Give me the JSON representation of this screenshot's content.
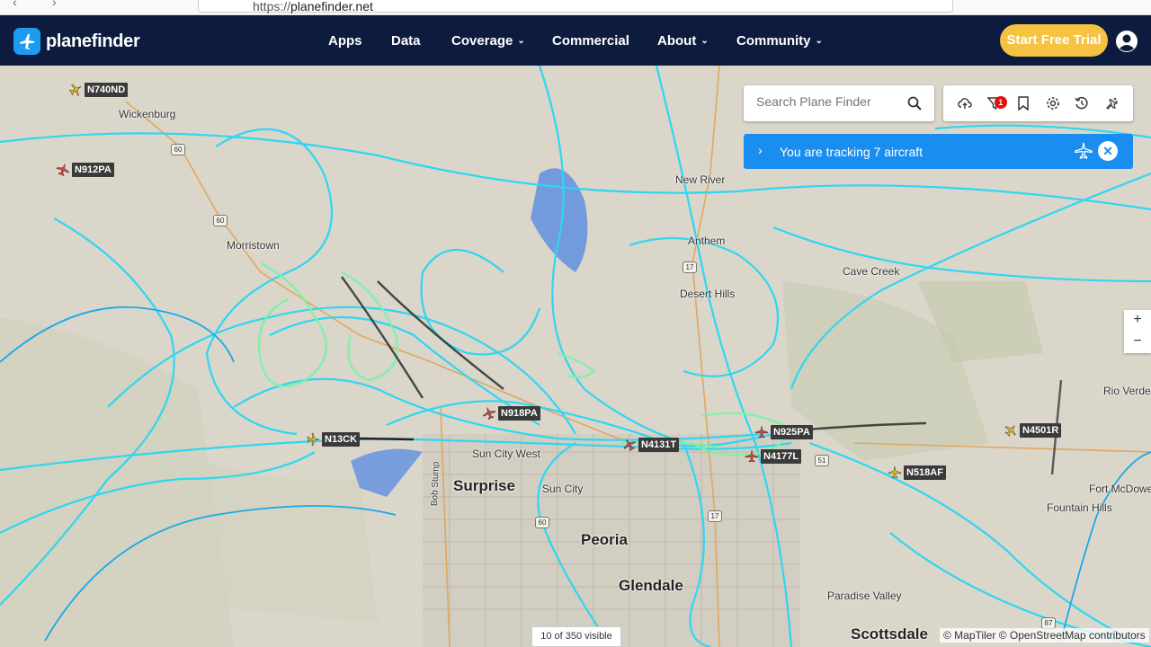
{
  "browser": {
    "url_prefix": "https://",
    "url_host": "planefinder.net"
  },
  "header": {
    "logo_text": "planefinder",
    "nav": [
      {
        "label": "Apps",
        "has_caret": false
      },
      {
        "label": "Data",
        "has_caret": false
      },
      {
        "label": "Coverage",
        "has_caret": true
      },
      {
        "label": "Commercial",
        "has_caret": false
      },
      {
        "label": "About",
        "has_caret": true
      },
      {
        "label": "Community",
        "has_caret": true
      }
    ],
    "cta_label": "Start Free Trial"
  },
  "search": {
    "placeholder": "Search Plane Finder"
  },
  "toolbar": {
    "filter_badge": "1"
  },
  "tracking": {
    "text": "You are tracking 7 aircraft"
  },
  "zoom": {
    "in": "+",
    "out": "−"
  },
  "footer": {
    "visible_count": "10 of 350 visible",
    "attribution": "© MapTiler © OpenStreetMap contributors"
  },
  "map": {
    "places": [
      {
        "name": "Wickenburg",
        "big": false
      },
      {
        "name": "New River",
        "big": false
      },
      {
        "name": "Anthem",
        "big": false
      },
      {
        "name": "Cave Creek",
        "big": false
      },
      {
        "name": "Desert Hills",
        "big": false
      },
      {
        "name": "Morristown",
        "big": false
      },
      {
        "name": "Sun City West",
        "big": false
      },
      {
        "name": "Surprise",
        "big": true
      },
      {
        "name": "Sun City",
        "big": false
      },
      {
        "name": "Peoria",
        "big": true
      },
      {
        "name": "Glendale",
        "big": true
      },
      {
        "name": "Paradise Valley",
        "big": false
      },
      {
        "name": "Scottsdale",
        "big": true
      },
      {
        "name": "Fountain Hills",
        "big": false
      },
      {
        "name": "Fort McDowell",
        "big": false
      },
      {
        "name": "Rio Verde",
        "big": false
      },
      {
        "name": "Bob Stump",
        "big": false
      }
    ],
    "aircraft": [
      {
        "callsign": "N740ND",
        "color": "#e8c21a"
      },
      {
        "callsign": "N912PA",
        "color": "#d9443a"
      },
      {
        "callsign": "N918PA",
        "color": "#d9443a"
      },
      {
        "callsign": "N13CK",
        "color": "#e8c21a"
      },
      {
        "callsign": "N4131T",
        "color": "#d9443a"
      },
      {
        "callsign": "N925PA",
        "color": "#d9443a"
      },
      {
        "callsign": "N4177L",
        "color": "#d9443a"
      },
      {
        "callsign": "N518AF",
        "color": "#e8c21a"
      },
      {
        "callsign": "N4501R",
        "color": "#e8c21a"
      }
    ],
    "shields": [
      "60",
      "60",
      "17",
      "51",
      "17",
      "60",
      "87"
    ],
    "colors": {
      "track": "#2fd6f2",
      "track_dark": "#1aa8e8",
      "track_green": "#7cf2a8",
      "accent": "#1a8ef0"
    }
  }
}
